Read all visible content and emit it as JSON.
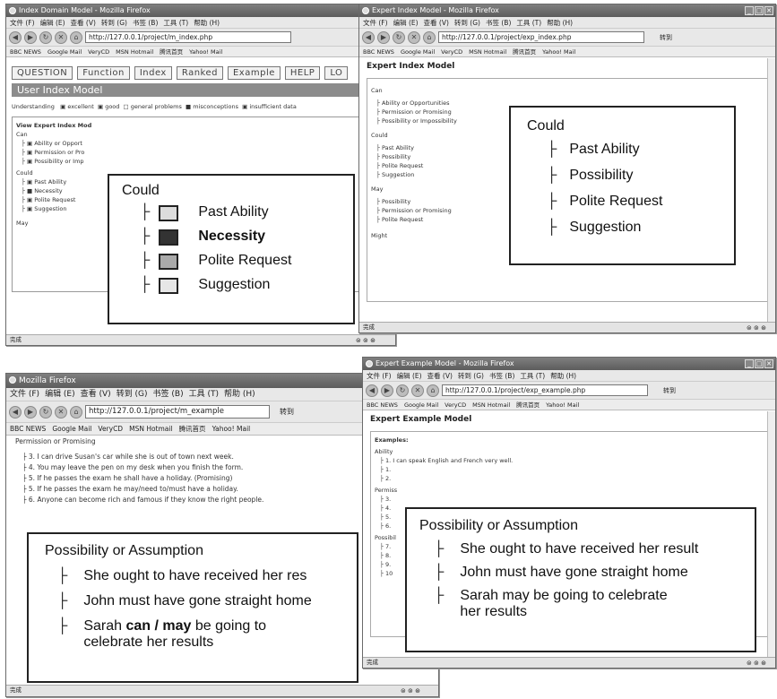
{
  "w1": {
    "title": "Index Domain Model - Mozilla Firefox",
    "menu": [
      "文件 (F)",
      "编辑 (E)",
      "查看 (V)",
      "转到 (G)",
      "书签 (B)",
      "工具 (T)",
      "帮助 (H)"
    ],
    "url": "http://127.0.0.1/project/m_index.php",
    "bookmarks": [
      "BBC NEWS",
      "Google Mail",
      "VeryCD",
      "MSN Hotmail",
      "腾讯首页",
      "Yahoo! Mail"
    ],
    "tabs": [
      "QUESTION",
      "Function",
      "Index",
      "Ranked",
      "Example",
      "HELP",
      "LO"
    ],
    "page_title": "User Index Model",
    "legend_label": "Understanding",
    "legend": [
      "excellent",
      "good",
      "general problems",
      "misconceptions",
      "insufficient data"
    ],
    "panel_title": "View Expert Index Mod",
    "can_label": "Can",
    "can_items": [
      "Ability or Opport",
      "Permission or Pro",
      "Possibility or Imp"
    ],
    "could_label": "Could",
    "could_items": [
      "Past Ability",
      "Necessity",
      "Polite Request",
      "Suggestion"
    ],
    "may_label": "May",
    "status": "完成"
  },
  "w2": {
    "title": "Expert Index Model - Mozilla Firefox",
    "menu": [
      "文件 (F)",
      "编辑 (E)",
      "查看 (V)",
      "转到 (G)",
      "书签 (B)",
      "工具 (T)",
      "帮助 (H)"
    ],
    "url": "http://127.0.0.1/project/exp_index.php",
    "go_label": "转到",
    "bookmarks": [
      "BBC NEWS",
      "Google Mail",
      "VeryCD",
      "MSN Hotmail",
      "腾讯首页",
      "Yahoo! Mail"
    ],
    "page_title": "Expert Index Model",
    "can_label": "Can",
    "can_items": [
      "Ability or Opportunities",
      "Permission or Promising",
      "Possibility or Impossibility"
    ],
    "could_label": "Could",
    "could_items": [
      "Past Ability",
      "Possibility",
      "Polite Request",
      "Suggestion"
    ],
    "may_label": "May",
    "may_items": [
      "Possibility",
      "Permission or Promising",
      "Polite Request"
    ],
    "might_label": "Might",
    "status": "完成"
  },
  "w3": {
    "title": "Mozilla Firefox",
    "menu": [
      "文件 (F)",
      "编辑 (E)",
      "查看 (V)",
      "转到 (G)",
      "书签 (B)",
      "工具 (T)",
      "帮助 (H)"
    ],
    "url": "http://127.0.0.1/project/m_example",
    "go_label": "转到",
    "bookmarks": [
      "BBC NEWS",
      "Google Mail",
      "VeryCD",
      "MSN Hotmail",
      "腾讯首页",
      "Yahoo! Mail"
    ],
    "section": "Permission or Promising",
    "items": [
      "3. I can drive Susan's car while she is out of town next week.",
      "4. You may leave the pen on my desk when you finish the form.",
      "5. If he passes the exam he shall have a holiday. (Promising)",
      "5. If he passes the exam he may/need to/must have a holiday.",
      "6. Anyone can become rich and famous if they know the right people."
    ],
    "status": "完成"
  },
  "w4": {
    "title": "Expert Example Model - Mozilla Firefox",
    "menu": [
      "文件 (F)",
      "编辑 (E)",
      "查看 (V)",
      "转到 (G)",
      "书签 (B)",
      "工具 (T)",
      "帮助 (H)"
    ],
    "url": "http://127.0.0.1/project/exp_example.php",
    "go_label": "转到",
    "bookmarks": [
      "BBC NEWS",
      "Google Mail",
      "VeryCD",
      "MSN Hotmail",
      "腾讯首页",
      "Yahoo! Mail"
    ],
    "page_title": "Expert Example Model",
    "examples_label": "Examples:",
    "ability_label": "Ability",
    "ability_item": "1. I can speak English and French very well.",
    "stubs_a": [
      "1.",
      "2."
    ],
    "permission_label": "Permiss",
    "stubs_b": [
      "3.",
      "4.",
      "5.",
      "6."
    ],
    "possibility_label": "Possibil",
    "stubs_c": [
      "7.",
      "8.",
      "9.",
      "10"
    ],
    "status": "完成"
  },
  "callouts": {
    "could_user": {
      "title": "Could",
      "items": [
        "Past Ability",
        "Necessity",
        "Polite Request",
        "Suggestion"
      ]
    },
    "could_expert": {
      "title": "Could",
      "items": [
        "Past Ability",
        "Possibility",
        "Polite Request",
        "Suggestion"
      ]
    },
    "poss_user": {
      "title": "Possibility or Assumption",
      "items": [
        "She ought to have received her res",
        "John must have gone straight home"
      ],
      "last_pre": "Sarah ",
      "last_bold": "can / may",
      "last_post": " be going to",
      "last_line2": "celebrate her results"
    },
    "poss_expert": {
      "title": "Possibility or Assumption",
      "items": [
        "She ought to have received her result",
        "John must have gone straight home"
      ],
      "last_line1": "Sarah may be going to celebrate",
      "last_line2": "her results"
    }
  },
  "colors": {
    "chrome": "#e8e8e8",
    "title": "#666666",
    "dark_swatch": "#333333",
    "mid_swatch": "#aaaaaa",
    "light_swatch": "#dddddd"
  }
}
